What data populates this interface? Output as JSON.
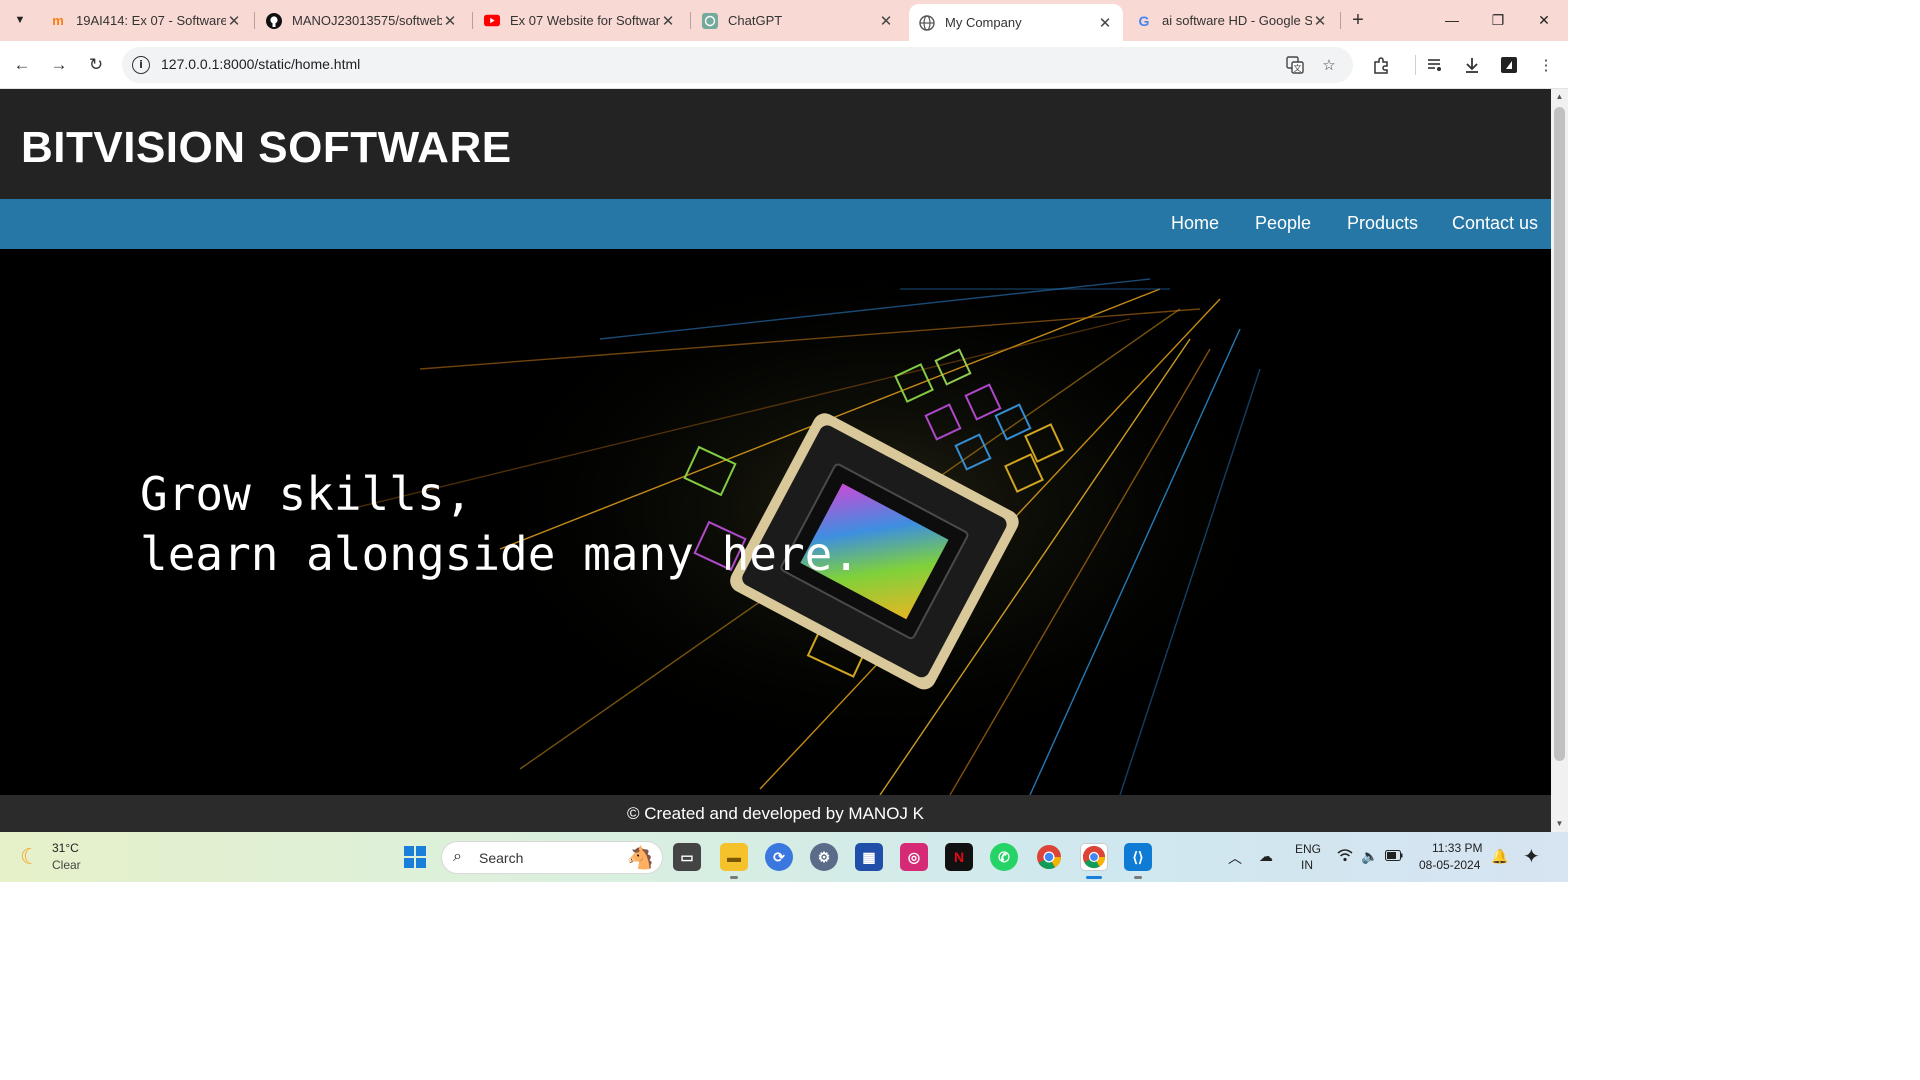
{
  "browser": {
    "tabs": [
      {
        "title": "19AI414: Ex 07 - Software E",
        "favicon": "moodle-icon",
        "active": false
      },
      {
        "title": "MANOJ23013575/softweb",
        "favicon": "github-icon",
        "active": false
      },
      {
        "title": "Ex 07 Website for Software",
        "favicon": "youtube-icon",
        "active": false
      },
      {
        "title": "ChatGPT",
        "favicon": "chatgpt-icon",
        "active": false
      },
      {
        "title": "My Company",
        "favicon": "globe-icon",
        "active": true
      },
      {
        "title": "ai software HD - Google Se",
        "favicon": "google-icon",
        "active": false
      }
    ],
    "url": "127.0.0.1:8000/static/home.html"
  },
  "page": {
    "title": "BITVISION SOFTWARE",
    "nav": [
      "Home",
      "People",
      "Products",
      "Contact us"
    ],
    "hero_line1": "Grow skills,",
    "hero_line2": "learn alongside many here.",
    "footer": "© Created and developed by MANOJ K"
  },
  "colors": {
    "header_bg": "#232323",
    "nav_bg": "#2677a5",
    "footer_bg": "#2b2b2b",
    "tabbar_bg": "#f9d9d4"
  },
  "taskbar": {
    "weather_temp": "31°C",
    "weather_cond": "Clear",
    "search_placeholder": "Search",
    "lang_line1": "ENG",
    "lang_line2": "IN",
    "time": "11:33 PM",
    "date": "08-05-2024"
  }
}
